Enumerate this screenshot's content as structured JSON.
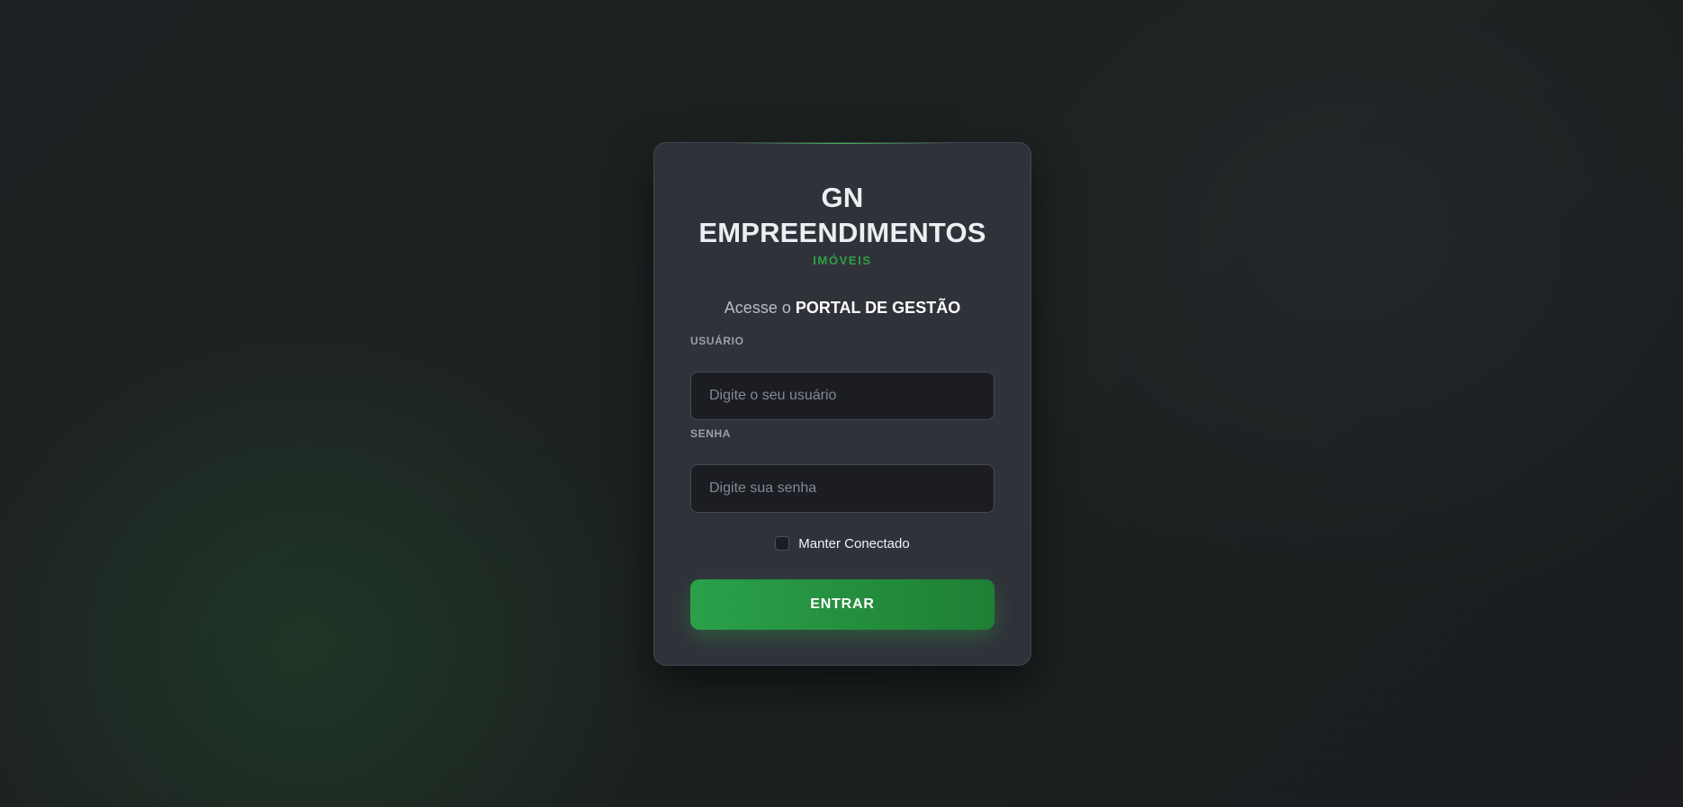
{
  "brand": {
    "title_line1": "GN",
    "title_line2": "EMPREENDIMENTOS",
    "subtitle": "IMÓVEIS"
  },
  "headline": {
    "prefix": "Acesse o ",
    "strong": "PORTAL DE GESTÃO"
  },
  "form": {
    "username": {
      "label": "USUÁRIO",
      "value": "",
      "placeholder": "Digite o seu usuário"
    },
    "password": {
      "label": "SENHA",
      "value": "",
      "placeholder": "Digite sua senha"
    },
    "remember": {
      "label": "Manter Conectado",
      "checked": false
    },
    "submit_label": "ENTRAR"
  },
  "colors": {
    "accent": "#2ea043",
    "card_background": "#30323a",
    "page_background": "#1c1f21",
    "input_background": "#1c1d22"
  }
}
